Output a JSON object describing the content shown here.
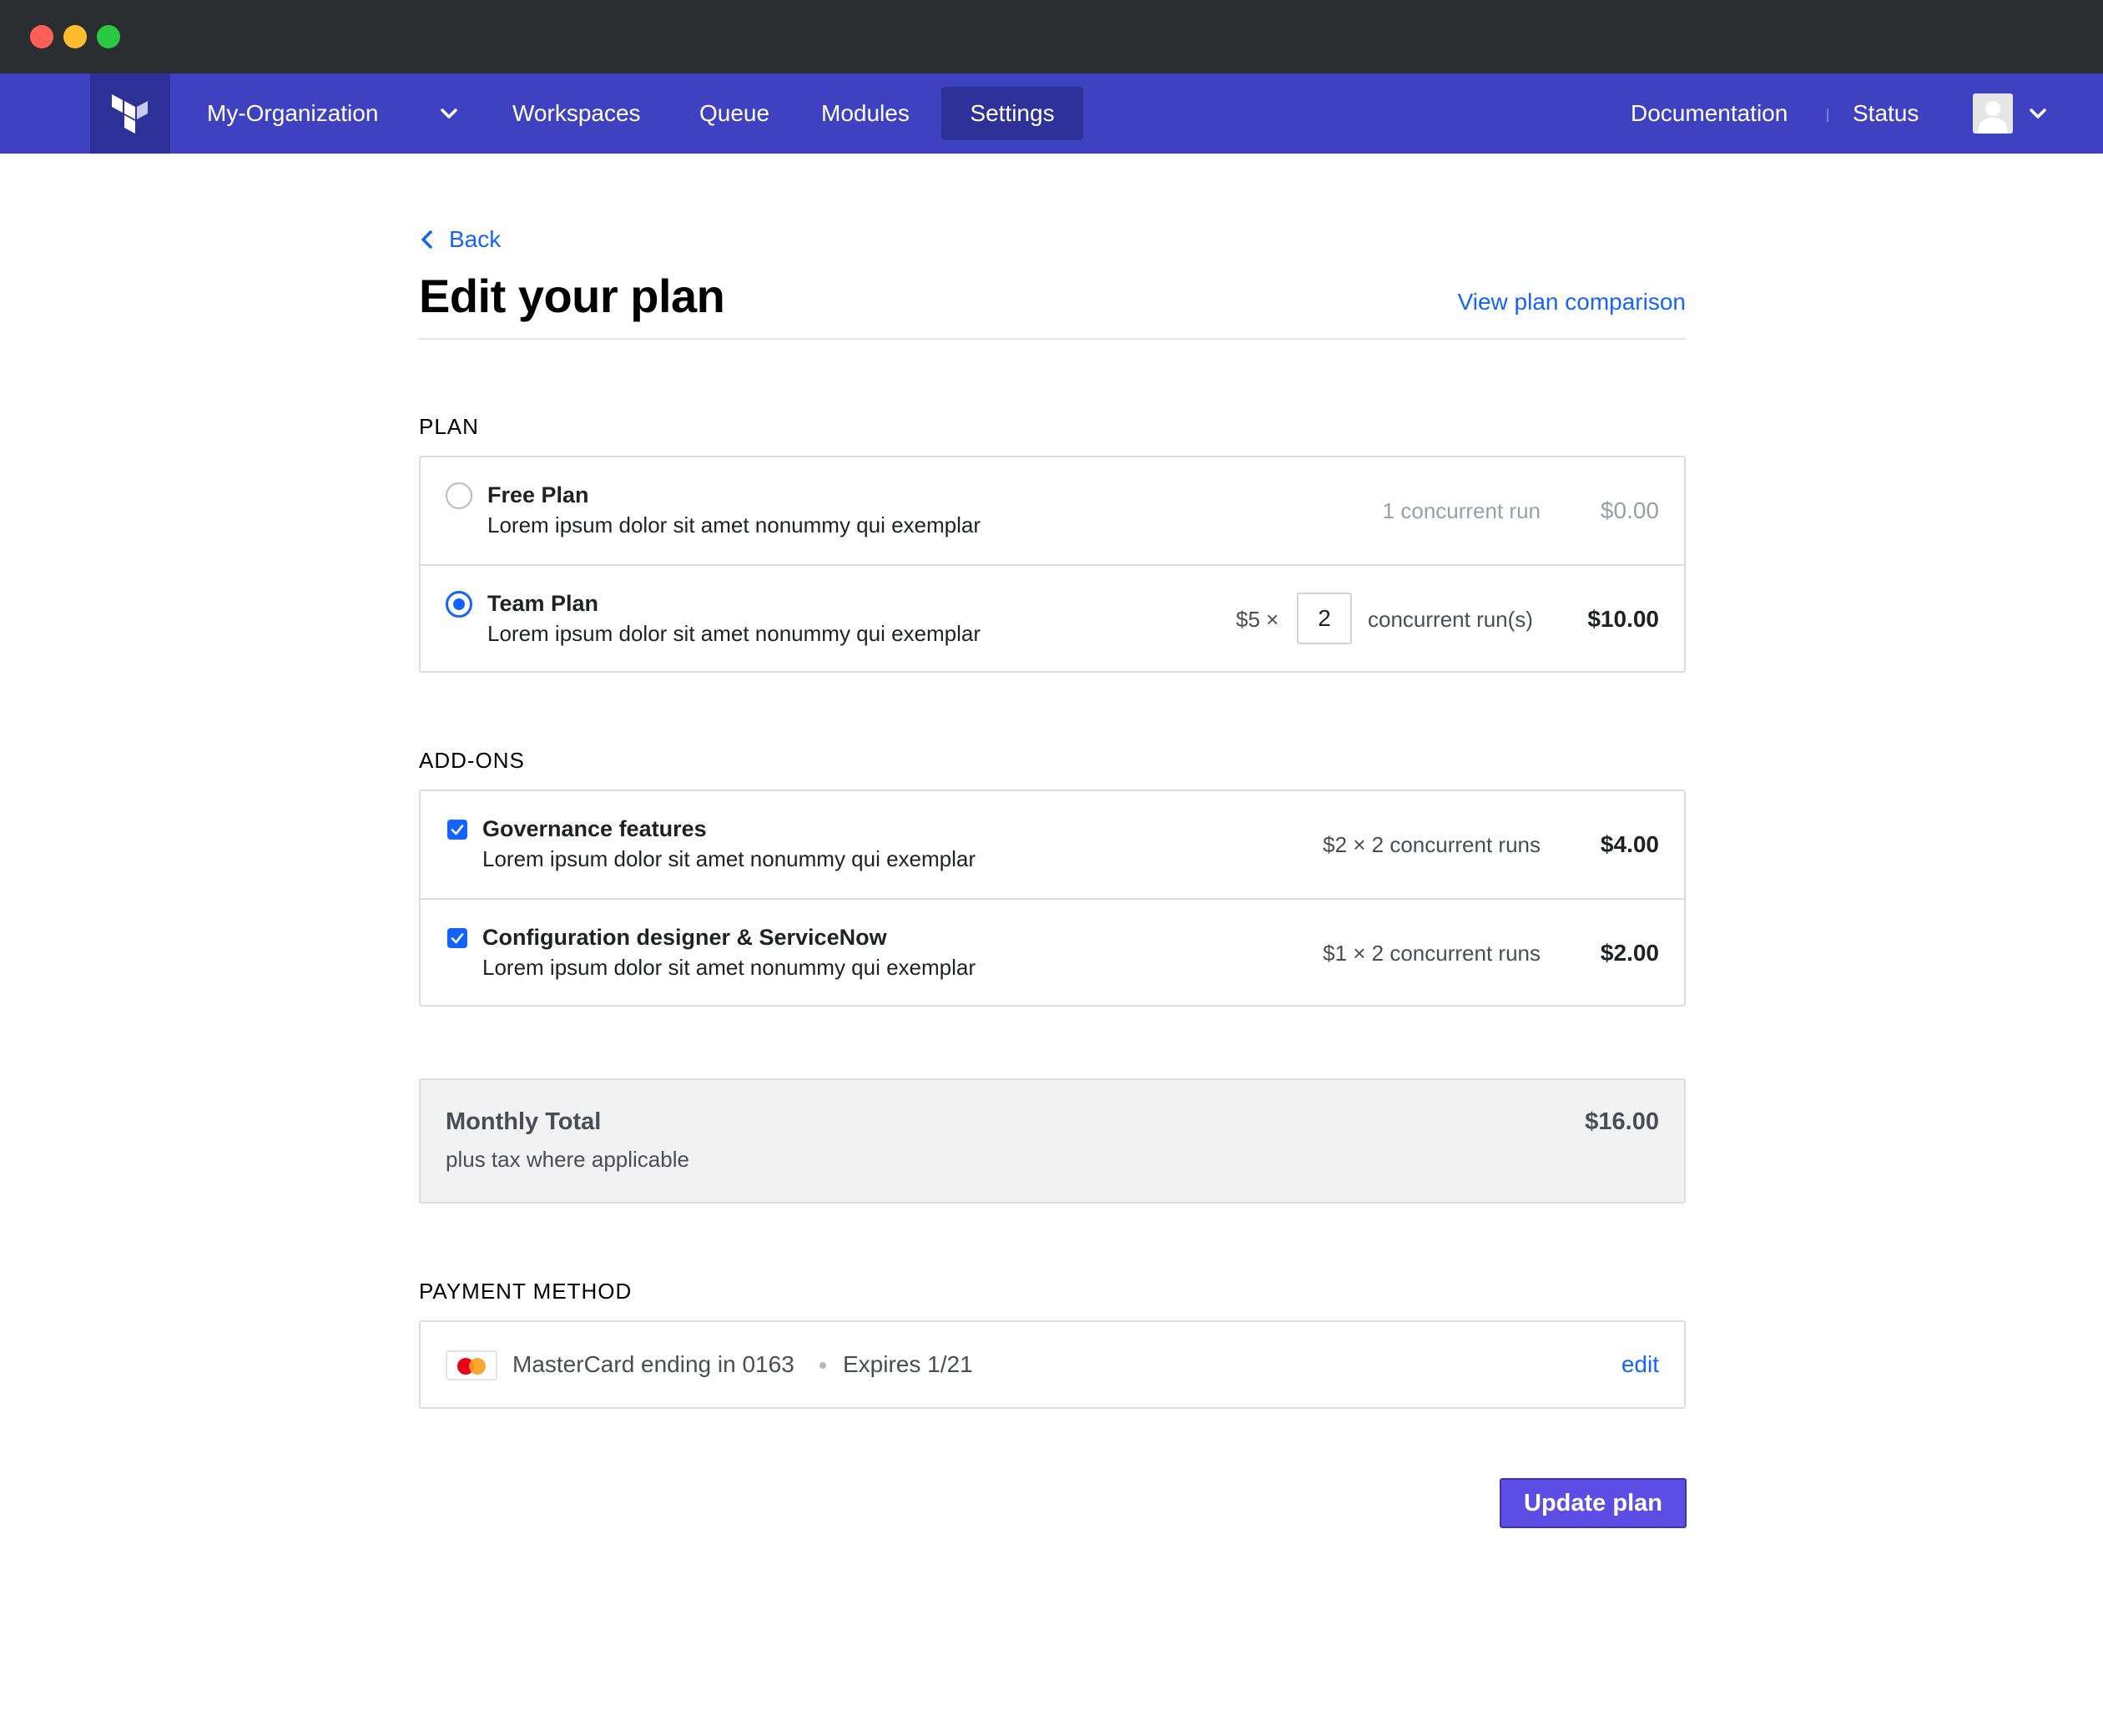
{
  "nav": {
    "org": "My-Organization",
    "items": [
      "Workspaces",
      "Queue",
      "Modules",
      "Settings"
    ],
    "docs": "Documentation",
    "status": "Status"
  },
  "page": {
    "back": "Back",
    "title": "Edit your plan",
    "compare": "View plan comparison"
  },
  "plan": {
    "label": "PLAN",
    "free": {
      "title": "Free Plan",
      "desc": "Lorem ipsum dolor sit amet nonummy qui exemplar",
      "runs": "1 concurrent run",
      "price": "$0.00"
    },
    "team": {
      "title": "Team Plan",
      "desc": "Lorem ipsum dolor sit amet nonummy qui exemplar",
      "unit": "$5 ×",
      "qty": "2",
      "runs": "concurrent run(s)",
      "price": "$10.00"
    }
  },
  "addons": {
    "label": "ADD-ONS",
    "items": [
      {
        "title": "Governance features",
        "desc": "Lorem ipsum dolor sit amet nonummy qui exemplar",
        "runs": "$2 × 2 concurrent runs",
        "price": "$4.00"
      },
      {
        "title": "Configuration designer & ServiceNow",
        "desc": "Lorem ipsum dolor sit amet nonummy qui exemplar",
        "runs": "$1 × 2 concurrent runs",
        "price": "$2.00"
      }
    ]
  },
  "total": {
    "title": "Monthly Total",
    "sub": "plus tax where applicable",
    "price": "$16.00"
  },
  "payment": {
    "label": "PAYMENT METHOD",
    "card": "MasterCard ending in 0163",
    "expires": "Expires 1/21",
    "edit": "edit"
  },
  "actions": {
    "update": "Update plan"
  },
  "colors": {
    "nav": "#3f42c0",
    "accent": "#1563ff",
    "button": "#5c4ee5"
  }
}
